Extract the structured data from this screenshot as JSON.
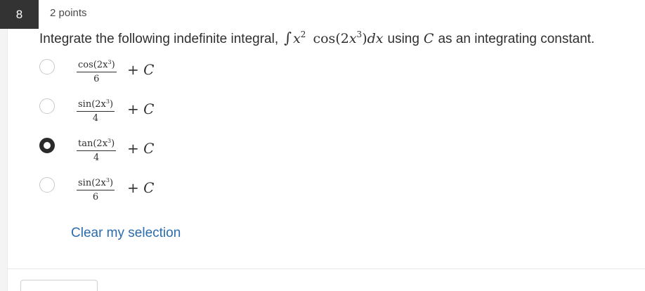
{
  "question": {
    "number": "8",
    "points": "2 points",
    "text_before": "Integrate the following indefinite integral,",
    "integral_symbol": "∫",
    "x_var": "x",
    "x_exp": "2",
    "func": "cos",
    "arg_open": "(2",
    "arg_var": "x",
    "arg_exp": "3",
    "arg_close": ")",
    "dx_d": "d",
    "dx_x": "x",
    "text_using": "using",
    "constant": "C",
    "text_after": "as an integrating constant."
  },
  "choices": [
    {
      "func": "cos",
      "arg": "(2x",
      "exp": "3",
      "close": ")",
      "den": "6",
      "plus": "+",
      "constant": "C",
      "selected": false
    },
    {
      "func": "sin",
      "arg": "(2x",
      "exp": "3",
      "close": ")",
      "den": "4",
      "plus": "+",
      "constant": "C",
      "selected": false
    },
    {
      "func": "tan",
      "arg": "(2x",
      "exp": "3",
      "close": ")",
      "den": "4",
      "plus": "+",
      "constant": "C",
      "selected": true
    },
    {
      "func": "sin",
      "arg": "(2x",
      "exp": "3",
      "close": ")",
      "den": "6",
      "plus": "+",
      "constant": "C",
      "selected": false
    }
  ],
  "clear_link": "Clear my selection",
  "colors": {
    "link": "#2a6cad",
    "badge_bg": "#333333"
  }
}
